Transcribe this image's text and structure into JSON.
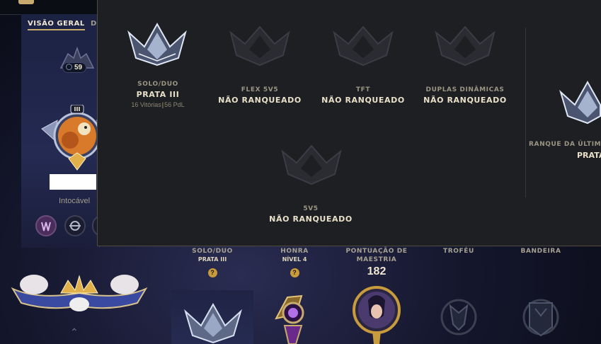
{
  "profile": {
    "tabs": [
      {
        "label": "VISÃO GERAL"
      },
      {
        "label": "D"
      }
    ],
    "level": "59",
    "tier_numeral": "III",
    "status": "Intocável"
  },
  "ranked_overlay": {
    "queues": [
      {
        "name": "SOLO/DUO",
        "rank": "PRATA III",
        "wins": "16 Vitórias",
        "separator": "|",
        "lp": "56 PdL"
      },
      {
        "name": "FLEX 5V5",
        "rank": "NÃO RANQUEADO"
      },
      {
        "name": "TFT",
        "rank": "NÃO RANQUEADO"
      },
      {
        "name": "DUPLAS DINÂMICAS",
        "rank": "NÃO RANQUEADO"
      },
      {
        "name": "5V5",
        "rank": "NÃO RANQUEADO"
      }
    ],
    "previous_season_label": "RANQUE DA ÚLTIMA",
    "previous_season_rank": "PRATA"
  },
  "summary": {
    "solo": {
      "label": "SOLO/DUO",
      "sub": "PRATA III",
      "help": "?"
    },
    "honor": {
      "label": "HONRA",
      "sub": "NÍVEL 4",
      "help": "?"
    },
    "mastery": {
      "label_line1": "PONTUAÇÃO DE",
      "label_line2": "MAESTRIA",
      "score": "182"
    },
    "trophy": {
      "label": "TROFÉU"
    },
    "banner": {
      "label": "BANDEIRA"
    }
  },
  "colors": {
    "accent": "#c8aa6e",
    "panel": "#1e1f23",
    "text_gold": "#cdbe91"
  },
  "icons": [
    "silver-emblem-icon",
    "unranked-emblem-icon",
    "honor-icon",
    "mastery-icon",
    "trophy-icon",
    "banner-icon",
    "chevron-up-icon"
  ]
}
